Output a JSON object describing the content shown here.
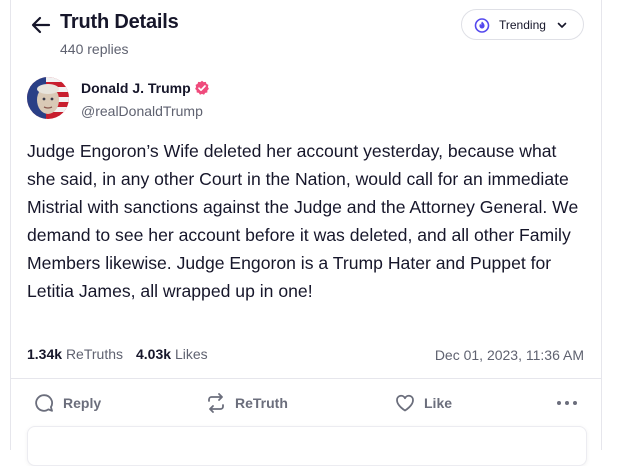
{
  "header": {
    "title": "Truth Details",
    "replies": "440 replies",
    "sort_label": "Trending"
  },
  "post": {
    "author_name": "Donald J. Trump",
    "handle": "@realDonaldTrump",
    "text": "Judge Engoron’s Wife deleted her account yesterday, because what she said, in any other Court in the Nation, would call for an immediate Mistrial with sanctions against the Judge and the Attorney General. We demand to see her account before it was deleted, and all other Family Members likewise. Judge Engoron is a Trump Hater and Puppet for Letitia James, all wrapped up in one!",
    "retruths_count": "1.34k",
    "retruths_label": "ReTruths",
    "likes_count": "4.03k",
    "likes_label": "Likes",
    "timestamp": "Dec 01, 2023, 11:36 AM"
  },
  "actions": {
    "reply": "Reply",
    "retruth": "ReTruth",
    "like": "Like"
  },
  "colors": {
    "accent": "#5448ee",
    "verified": "#ef4b7c",
    "text": "#16162a",
    "muted": "#5f6270"
  },
  "icons": [
    "back-arrow-icon",
    "flame-icon",
    "chevron-down-icon",
    "verified-badge-icon",
    "reply-icon",
    "retruth-icon",
    "like-icon",
    "more-icon"
  ]
}
